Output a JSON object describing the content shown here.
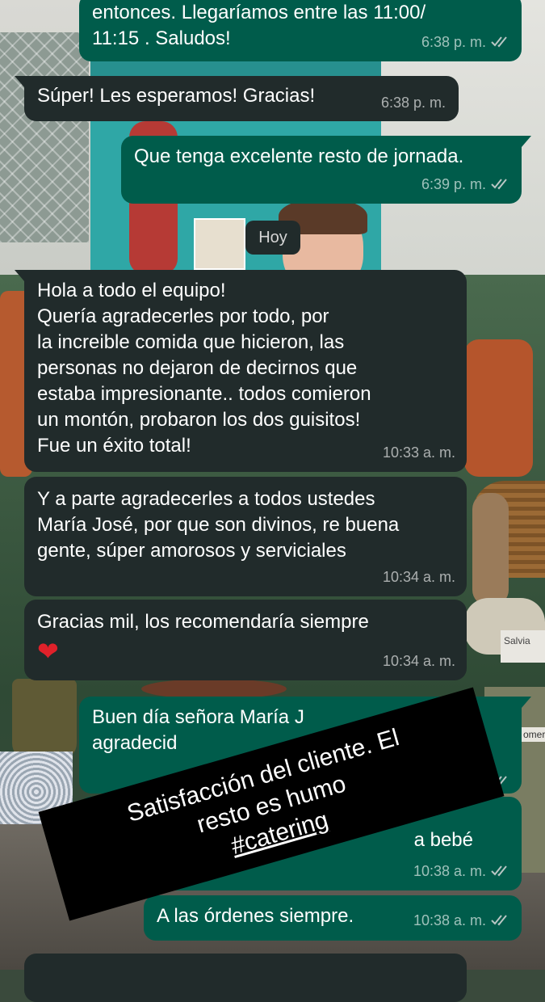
{
  "chat": {
    "messages": [
      {
        "id": "m1",
        "direction": "out",
        "text": "entonces. Llegaríamos entre las 11:00/\n11:15 . Saludos!",
        "time": "6:38 p. m.",
        "status": "read"
      },
      {
        "id": "m2",
        "direction": "in",
        "text": "Súper! Les esperamos! Gracias!",
        "time": "6:38 p. m."
      },
      {
        "id": "m3",
        "direction": "out",
        "text": "Que tenga excelente resto de jornada.",
        "time": "6:39 p. m.",
        "status": "read"
      },
      {
        "id": "m4",
        "direction": "in",
        "text": "Hola a todo el equipo!\nQuería agradecerles por todo, por\nla increible comida que hicieron, las\npersonas no dejaron de decirnos que\nestaba impresionante.. todos comieron\nun montón, probaron los dos guisitos!\nFue un éxito total!",
        "time": "10:33 a. m."
      },
      {
        "id": "m5",
        "direction": "in",
        "text": "Y a parte agradecerles a todos ustedes\nMaría José, por que son divinos, re buena\ngente, súper amorosos y serviciales",
        "time": "10:34 a. m."
      },
      {
        "id": "m6",
        "direction": "in",
        "text": "Gracias mil, los recomendaría siempre",
        "emoji": "❤",
        "time": "10:34 a. m."
      },
      {
        "id": "m7",
        "direction": "out",
        "text": "Buen día señora María J\nagradecid",
        "status": "read"
      },
      {
        "id": "m8",
        "direction": "out",
        "text": "a bebé",
        "time": "10:38 a. m.",
        "status": "read"
      },
      {
        "id": "m9",
        "direction": "out",
        "text": "A las órdenes siempre.",
        "time": "10:38 a. m.",
        "status": "read"
      }
    ],
    "day_separator": "Hoy"
  },
  "wallpaper": {
    "sign_label": "Salvia",
    "partial_label": "omero"
  },
  "sticker": {
    "line1": "Satisfacción del cliente. El",
    "line2": "resto es humo",
    "hashtag": "#catering"
  },
  "colors": {
    "incoming_bubble": "#212b2b",
    "outgoing_bubble": "#005c4b",
    "read_ticks": "#b9c6c4",
    "heart": "#e0212a",
    "sticker_bg": "#000000"
  },
  "icons": {
    "read_receipt": "double-check-icon",
    "emoji": "red-heart-emoji"
  }
}
